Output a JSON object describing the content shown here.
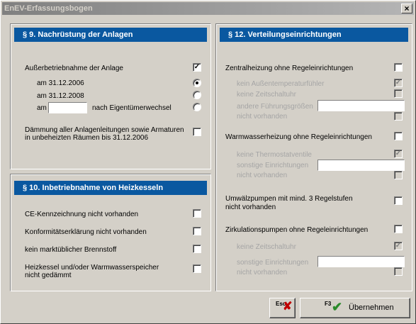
{
  "window": {
    "title": "EnEV-Erfassungsbogen",
    "close_glyph": "×"
  },
  "s9": {
    "header": "§ 9. Nachrüstung der Anlagen",
    "ausser": {
      "label": "Außerbetriebnahme der Anlage",
      "checked": true
    },
    "opt1": "am 31.12.2006",
    "opt2": "am 31.12.2008",
    "opt3_prefix": "am",
    "opt3_suffix": "nach Eigentümerwechsel",
    "opt3_value": "",
    "selected_option": 1,
    "daemm_line1": "Dämmung aller Anlagenleitungen sowie Armaturen",
    "daemm_line2": "in unbeheizten Räumen bis 31.12.2006",
    "daemm_checked": false
  },
  "s10": {
    "header": "§ 10. Inbetriebnahme von Heizkesseln",
    "ce": "CE-Kennzeichnung nicht vorhanden",
    "konf": "Konformitätserklärung nicht vorhanden",
    "brenn": "kein marktüblicher Brennstoff",
    "heiz_line1": "Heizkessel und/oder Warmwasserspeicher",
    "heiz_line2": "nicht gedämmt"
  },
  "s12": {
    "header": "§ 12. Verteilungseinrichtungen",
    "zentral": "Zentralheizung ohne Regeleinrichtungen",
    "z_fuehler": "kein Außentemperaturfühler",
    "z_uhr": "keine Zeitschaltuhr",
    "z_andere_1": "andere Führungsgrößen",
    "z_andere_2": "nicht vorhanden",
    "ww": "Warmwasserheizung ohne Regeleinrichtungen",
    "ww_thermo": "keine Thermostatventile",
    "ww_sonst_1": "sonstige Einrichtungen",
    "ww_sonst_2": "nicht vorhanden",
    "umw_line1": "Umwälzpumpen mit mind. 3 Regelstufen",
    "umw_line2": "nicht vorhanden",
    "zirk": "Zirkulationspumpen ohne Regeleinrichtungen",
    "zk_uhr": "keine Zeitschaltuhr",
    "zk_sonst_1": "sonstige Einrichtungen",
    "zk_sonst_2": "nicht vorhanden"
  },
  "buttons": {
    "esc_key": "Esc",
    "f3_key": "F3",
    "uebernehmen": "Übernehmen"
  },
  "icons": {
    "cancel": "close-x-icon",
    "confirm": "checkmark-icon"
  },
  "colors": {
    "header_bg": "#0a58a0",
    "cancel": "#c00000",
    "confirm": "#2a8a2a"
  }
}
